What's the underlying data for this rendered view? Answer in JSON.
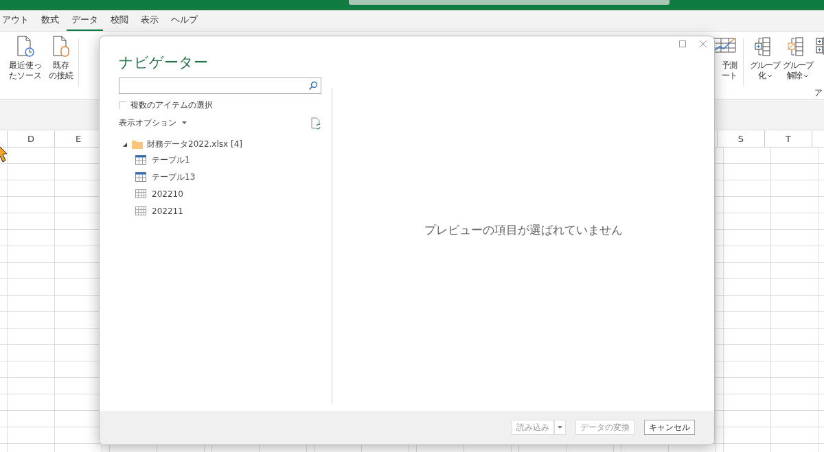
{
  "ribbon_tabs": [
    {
      "label": "アウト",
      "selected": false
    },
    {
      "label": "数式",
      "selected": false
    },
    {
      "label": "データ",
      "selected": true
    },
    {
      "label": "校閲",
      "selected": false
    },
    {
      "label": "表示",
      "selected": false
    },
    {
      "label": "ヘルプ",
      "selected": false
    }
  ],
  "ribbon_left": [
    {
      "kind": "recent",
      "lines": [
        "最近使っ",
        "たソース"
      ],
      "menu": false
    },
    {
      "kind": "existing",
      "lines": [
        "既存",
        "の接続"
      ],
      "menu": false
    }
  ],
  "ribbon_right": [
    {
      "kind": "forecast",
      "lines": [
        "予測",
        "ート"
      ],
      "menu": false
    },
    {
      "kind": "group",
      "lines": [
        "グループ",
        "化"
      ],
      "menu": true
    },
    {
      "kind": "ungroup",
      "lines": [
        "グループ",
        "解除"
      ],
      "menu": true
    },
    {
      "kind": "subtotal",
      "menu": false
    }
  ],
  "ribbon_group_label": "ア",
  "columns_left": [
    "D",
    "E"
  ],
  "columns_right": [
    "S",
    "T"
  ],
  "dialog": {
    "title": "ナビゲーター",
    "multi_select": {
      "label": "複数のアイテムの選択",
      "checked": false
    },
    "view_options": "表示オプション",
    "tree": {
      "label": "財務データ2022.xlsx [4]",
      "expanded": true,
      "children": [
        {
          "label": "テーブル1",
          "kind": "table"
        },
        {
          "label": "テーブル13",
          "kind": "table"
        },
        {
          "label": "202210",
          "kind": "sheet"
        },
        {
          "label": "202211",
          "kind": "sheet"
        }
      ]
    },
    "preview_message": "プレビューの項目が選ばれていません",
    "buttons": [
      {
        "label": "読み込み",
        "kind": "split",
        "disabled": true
      },
      {
        "label": "データの変換",
        "kind": "plain",
        "disabled": true
      },
      {
        "label": "キャンセル",
        "kind": "plain",
        "disabled": false
      }
    ]
  }
}
